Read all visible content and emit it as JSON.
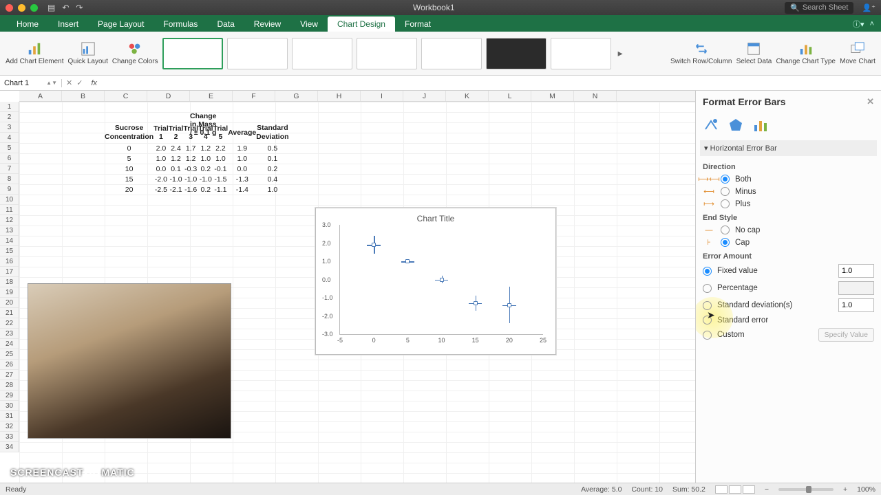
{
  "titlebar": {
    "doc": "Workbook1",
    "search_placeholder": "Search Sheet"
  },
  "tabs": [
    "Home",
    "Insert",
    "Page Layout",
    "Formulas",
    "Data",
    "Review",
    "View",
    "Chart Design",
    "Format"
  ],
  "active_tab": "Chart Design",
  "ribbon": {
    "left": [
      {
        "label": "Add Chart Element"
      },
      {
        "label": "Quick Layout"
      },
      {
        "label": "Change Colors"
      }
    ],
    "right": [
      {
        "label": "Switch Row/Column"
      },
      {
        "label": "Select Data"
      },
      {
        "label": "Change Chart Type"
      },
      {
        "label": "Move Chart"
      }
    ]
  },
  "namebox": "Chart 1",
  "fx": "fx",
  "columns": [
    "A",
    "B",
    "C",
    "D",
    "E",
    "F",
    "G",
    "H",
    "I",
    "J",
    "K",
    "L",
    "M",
    "N"
  ],
  "rowcount": 34,
  "table": {
    "title": "Change in Mass /  ± 0.1 g",
    "header1": [
      "Sucrose Concentration",
      "Trial 1",
      "Trial 2",
      "Trial 3",
      "Trial 4",
      "Trial 5",
      "Average",
      "Standard Deviation"
    ],
    "rows": [
      [
        "0",
        "2.0",
        "2.4",
        "1.7",
        "1.2",
        "2.2",
        "1.9",
        "0.5"
      ],
      [
        "5",
        "1.0",
        "1.2",
        "1.2",
        "1.0",
        "1.0",
        "1.0",
        "0.1"
      ],
      [
        "10",
        "0.0",
        "0.1",
        "-0.3",
        "0.2",
        "-0.1",
        "0.0",
        "0.2"
      ],
      [
        "15",
        "-2.0",
        "-1.0",
        "-1.0",
        "-1.0",
        "-1.5",
        "-1.3",
        "0.4"
      ],
      [
        "20",
        "-2.5",
        "-2.1",
        "-1.6",
        "0.2",
        "-1.1",
        "-1.4",
        "1.0"
      ]
    ]
  },
  "chart_data": {
    "type": "scatter",
    "title": "Chart Title",
    "xlabel": "",
    "ylabel": "",
    "xlim": [
      -5,
      25
    ],
    "ylim": [
      -3,
      3
    ],
    "yticks": [
      -3,
      -2,
      -1,
      0,
      1,
      2,
      3
    ],
    "xticks": [
      -5,
      0,
      5,
      10,
      15,
      20,
      25
    ],
    "x": [
      0,
      5,
      10,
      15,
      20
    ],
    "y": [
      1.9,
      1.0,
      0.0,
      -1.3,
      -1.4
    ],
    "x_error": 1.0,
    "y_error": [
      0.5,
      0.1,
      0.2,
      0.4,
      1.0
    ]
  },
  "pane": {
    "title": "Format Error Bars",
    "section": "Horizontal Error Bar",
    "direction_label": "Direction",
    "direction": {
      "both": "Both",
      "minus": "Minus",
      "plus": "Plus",
      "selected": "both"
    },
    "endstyle_label": "End Style",
    "endstyle": {
      "nocap": "No cap",
      "cap": "Cap",
      "selected": "cap"
    },
    "amount_label": "Error Amount",
    "amount": {
      "fixed": "Fixed value",
      "percentage": "Percentage",
      "stddev": "Standard deviation(s)",
      "stderr": "Standard error",
      "custom": "Custom",
      "selected": "fixed",
      "fixed_value": "1.0",
      "stddev_value": "1.0",
      "specify": "Specify Value"
    }
  },
  "status": {
    "ready": "Ready",
    "avg": "Average: 5.0",
    "count": "Count: 10",
    "sum": "Sum: 50.2",
    "zoom": "100%"
  },
  "watermark": "SCREENCAST    MATIC"
}
